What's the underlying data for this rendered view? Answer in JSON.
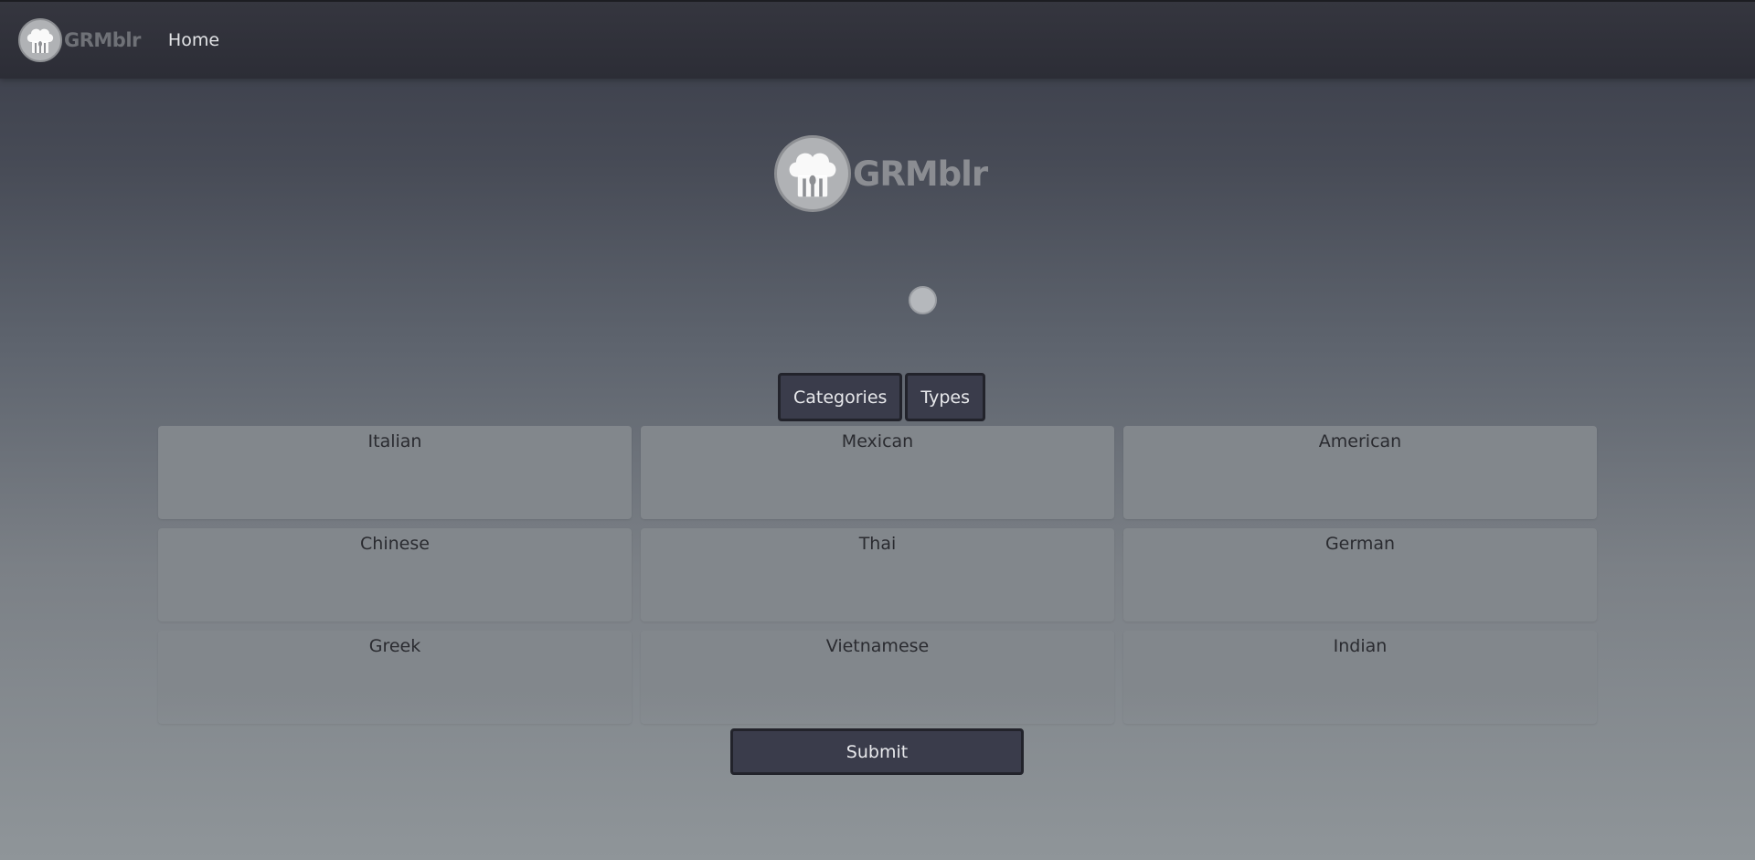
{
  "navbar": {
    "brand_name": "GRMblr",
    "home_label": "Home",
    "logo_icon": "chef-hat-utensils-icon"
  },
  "hero": {
    "brand_name": "GRMblr",
    "logo_icon": "chef-hat-utensils-icon"
  },
  "toggle": {
    "categories_label": "Categories",
    "types_label": "Types"
  },
  "cuisines": [
    {
      "label": "Italian"
    },
    {
      "label": "Mexican"
    },
    {
      "label": "American"
    },
    {
      "label": "Chinese"
    },
    {
      "label": "Thai"
    },
    {
      "label": "German"
    },
    {
      "label": "Greek"
    },
    {
      "label": "Vietnamese"
    },
    {
      "label": "Indian"
    }
  ],
  "submit_label": "Submit",
  "colors": {
    "navbar_bg": "#2c2d36",
    "button_bg": "#3a3c4b",
    "tile_bg": "#82878c",
    "brand_text": "#8b8d92"
  }
}
